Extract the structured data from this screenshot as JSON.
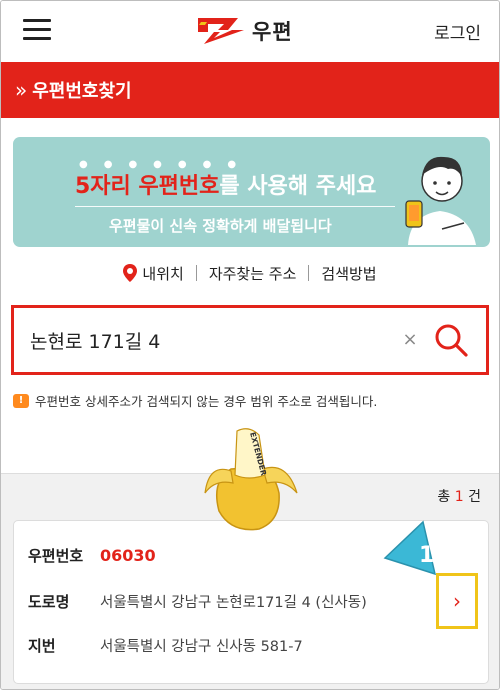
{
  "header": {
    "menu_icon": "hamburger-menu-icon",
    "logo_text": "우편",
    "login": "로그인"
  },
  "titlebar": {
    "chevron": "»",
    "title": "우편번호찾기"
  },
  "banner": {
    "main_red": "5자리 우편번호",
    "main_rest": "를 사용해 주세요",
    "sub": "우편물이 신속 정확하게 배달됩니다"
  },
  "shortcuts": {
    "items": [
      "내위치",
      "자주찾는 주소",
      "검색방법"
    ]
  },
  "search": {
    "value": "논현로 171길 4",
    "clear": "×"
  },
  "notice": {
    "icon": "!",
    "text": "우편번호 상세주소가 검색되지 않는 경우 범위 주소로 검색됩니다."
  },
  "results": {
    "count_prefix": "총",
    "count": "1",
    "count_suffix": "건",
    "items": [
      {
        "zip_label": "우편번호",
        "zip": "06030",
        "road_label": "도로명",
        "road": "서울특별시 강남구 논현로171길 4 (신사동)",
        "lot_label": "지번",
        "lot": "서울특별시 강남구 신사동 581-7",
        "arrow": "›"
      }
    ]
  },
  "overlay": {
    "banana_text": "EXTENDER",
    "callout_number": "1"
  },
  "colors": {
    "brand_red": "#e2231a",
    "banner_bg": "#9fd3cf",
    "highlight": "#f0c419",
    "callout": "#3bb8d6"
  }
}
